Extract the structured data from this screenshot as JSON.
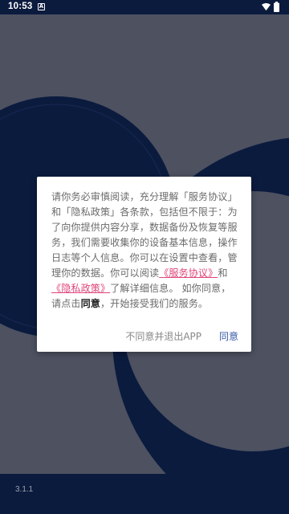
{
  "status_bar": {
    "time": "10:53",
    "notification_icon": "A",
    "wifi_icon": "wifi-icon",
    "battery_icon": "battery-icon"
  },
  "dialog": {
    "message": {
      "part1": "请你务必审慎阅读，充分理解「服务协议」和「隐私政策」各条款，包括但不限于：为了向你提供内容分享，数据备份及恢复等服务，我们需要收集你的设备基本信息，操作日志等个人信息。你可以在设置中查看，管理你的数据。你可以阅读",
      "link_service": "《服务协议》",
      "and": "和",
      "link_privacy": "《隐私政策》",
      "part2": "了解详细信息。 如你同意，请点击",
      "strong_agree": "同意",
      "part3": "，开始接受我们的服务。"
    },
    "decline_button": "不同意并退出APP",
    "agree_button": "同意"
  },
  "version": "3.1.1",
  "colors": {
    "navy": "#0b1b3e",
    "link": "#e0457b",
    "agree": "#3a5aa8"
  }
}
